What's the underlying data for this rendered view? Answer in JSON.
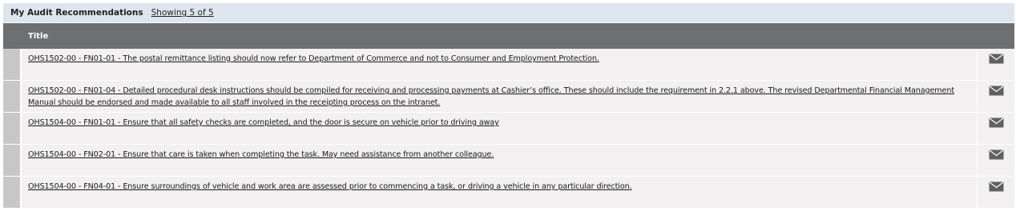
{
  "panel": {
    "title": "My Audit Recommendations",
    "count": "Showing 5 of 5"
  },
  "table": {
    "columns": [
      "Title"
    ],
    "rows": [
      {
        "title": "OHS1502-00 - FN01-01 - The postal remittance listing should now refer to Department of Commerce and not to Consumer and Employment Protection."
      },
      {
        "title": "OHS1502-00 - FN01-04 - Detailed procedural desk instructions should be compiled for receiving and processing payments at Cashier’s office. These should include the requirement in 2.2.1 above. The revised Departmental Financial Management Manual should be endorsed and made available to all staff involved in the receipting process on the intranet."
      },
      {
        "title": "OHS1504-00 - FN01-01 - Ensure that all safety checks are completed, and the door is secure on vehicle prior to driving away"
      },
      {
        "title": "OHS1504-00 - FN02-01 - Ensure that care is taken when completing the task. May need assistance from another colleague."
      },
      {
        "title": "OHS1504-00 - FN04-01 - Ensure surroundings of vehicle and work area are assessed prior to commencing a task, or driving a vehicle in any particular direction."
      }
    ],
    "row_action_icon": "mail-icon"
  },
  "colors": {
    "header_bg": "#dde6ee",
    "column_header_bg": "#6e6f71",
    "row_bg": "#f2f0f0",
    "row_selector": "#c7c7c7",
    "icon": "#5f6062"
  }
}
